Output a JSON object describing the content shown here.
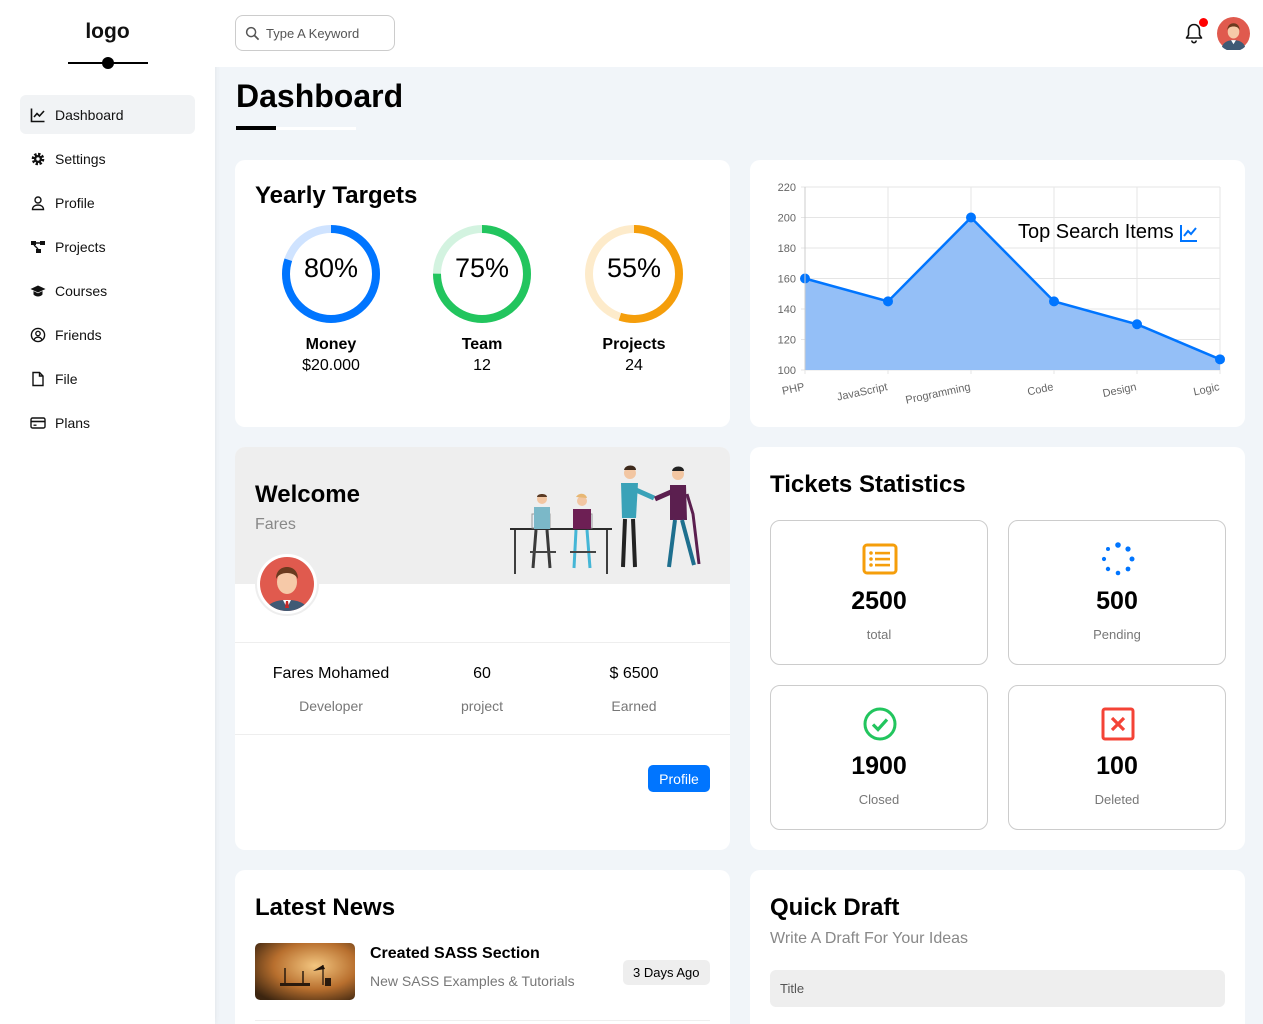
{
  "sidebar": {
    "logo": "logo",
    "items": [
      {
        "label": "Dashboard",
        "icon": "chart-line-icon",
        "active": true
      },
      {
        "label": "Settings",
        "icon": "gear-icon"
      },
      {
        "label": "Profile",
        "icon": "user-icon"
      },
      {
        "label": "Projects",
        "icon": "diagram-project-icon"
      },
      {
        "label": "Courses",
        "icon": "graduation-cap-icon"
      },
      {
        "label": "Friends",
        "icon": "circle-user-icon"
      },
      {
        "label": "File",
        "icon": "file-icon"
      },
      {
        "label": "Plans",
        "icon": "credit-card-icon"
      }
    ]
  },
  "topbar": {
    "search_placeholder": "Type A Keyword",
    "notification_dot_color": "#ff0000"
  },
  "page": {
    "title": "Dashboard"
  },
  "targets": {
    "title": "Yearly Targets",
    "items": [
      {
        "percent": 80,
        "percent_label": "80%",
        "name": "Money",
        "value": "$20.000",
        "color": "#0075ff",
        "track": "#cfe3ff"
      },
      {
        "percent": 75,
        "percent_label": "75%",
        "name": "Team",
        "value": "12",
        "color": "#22c55e",
        "track": "#d3f3e0"
      },
      {
        "percent": 55,
        "percent_label": "55%",
        "name": "Projects",
        "value": "24",
        "color": "#f59e0b",
        "track": "#fdebcb"
      }
    ]
  },
  "chart_data": {
    "type": "area",
    "title": "Top Search Items",
    "categories": [
      "PHP",
      "JavaScript",
      "Programming",
      "Code",
      "Design",
      "Logic"
    ],
    "values": [
      160,
      145,
      200,
      145,
      130,
      107
    ],
    "ylim": [
      100,
      220
    ],
    "yticks": [
      "100",
      "120",
      "140",
      "160",
      "180",
      "200",
      "220"
    ],
    "grid": true,
    "line_color": "#0075ff",
    "fill_color": "#94bff7"
  },
  "welcome": {
    "title": "Welcome",
    "name": "Fares",
    "stats": [
      {
        "value": "Fares Mohamed",
        "label": "Developer"
      },
      {
        "value": "60",
        "label": "project"
      },
      {
        "value": "$ 6500",
        "label": "Earned"
      }
    ],
    "button": "Profile"
  },
  "tickets": {
    "title": "Tickets Statistics",
    "items": [
      {
        "number": "2500",
        "label": "total",
        "icon": "rectangle-list-icon",
        "color": "#f59e0b"
      },
      {
        "number": "500",
        "label": "Pending",
        "icon": "spinner-icon",
        "color": "#0075ff"
      },
      {
        "number": "1900",
        "label": "Closed",
        "icon": "circle-check-icon",
        "color": "#22c55e"
      },
      {
        "number": "100",
        "label": "Deleted",
        "icon": "rectangle-xmark-icon",
        "color": "#f44336"
      }
    ]
  },
  "news": {
    "title": "Latest News",
    "items": [
      {
        "title": "Created SASS Section",
        "subtitle": "New SASS Examples & Tutorials",
        "time": "3 Days Ago"
      }
    ]
  },
  "draft": {
    "title": "Quick Draft",
    "subtitle": "Write A Draft For Your Ideas",
    "title_placeholder": "Title"
  }
}
